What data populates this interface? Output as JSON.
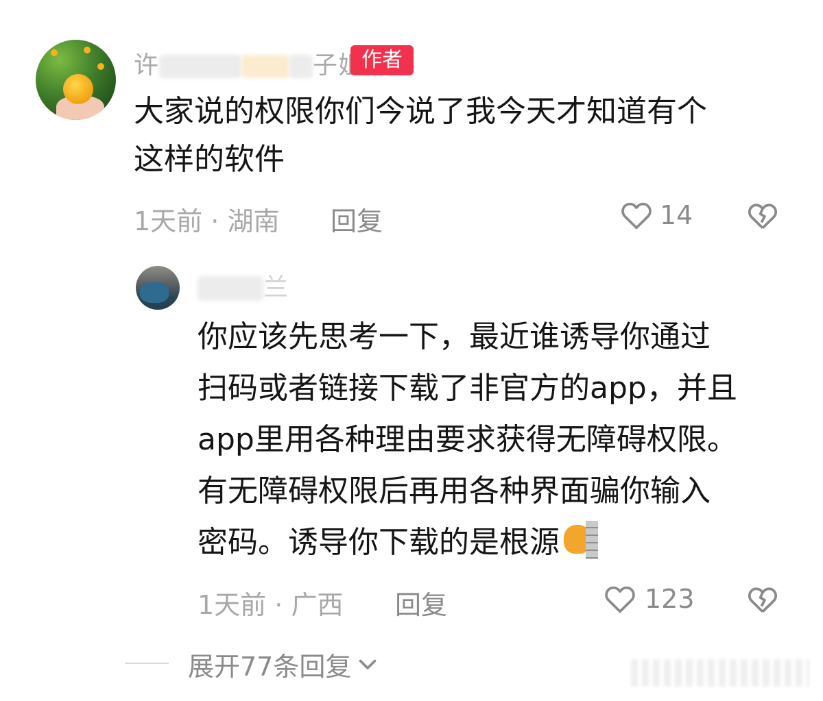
{
  "comment": {
    "username_start": "许",
    "username_end": "子姐",
    "author_badge": "作者",
    "text_line1": "大家说的权限你们今说了我今天才知道有个",
    "text_line2": "这样的软件",
    "time": "1天前",
    "separator": "·",
    "location": "湖南",
    "reply_label": "回复",
    "like_count": "14"
  },
  "reply": {
    "username_end": "兰",
    "text_lines": [
      "你应该先思考一下，最近谁诱导你通过",
      "扫码或者链接下载了非官方的app，并且",
      "app里用各种理由要求获得无障碍权限。",
      "有无障碍权限后再用各种界面骗你输入",
      "密码。诱导你下载的是根源"
    ],
    "emoji": "cat-behind-wall-emoji",
    "time": "1天前",
    "separator": "·",
    "location": "广西",
    "reply_label": "回复",
    "like_count": "123"
  },
  "expand_replies": {
    "label": "展开77条回复"
  },
  "colors": {
    "badge_bg": "#f2324d",
    "text": "#151515",
    "meta": "#a8a8a8"
  }
}
